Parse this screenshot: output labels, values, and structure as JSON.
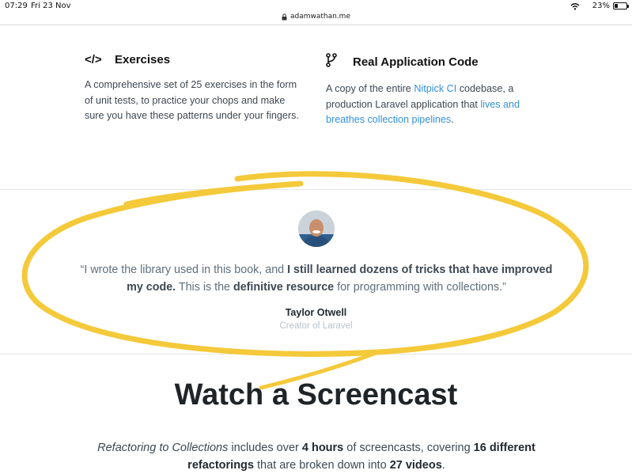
{
  "status_bar": {
    "time": "07:29",
    "date": "Fri 23 Nov",
    "battery": "23%",
    "battery_level": 0.23,
    "icons": [
      "wifi-icon",
      "moon-icon",
      "battery-icon"
    ]
  },
  "browser": {
    "url": "adamwathan.me",
    "lock_icon": "lock-icon"
  },
  "features": [
    {
      "icon": "code-icon",
      "icon_glyph": "</>",
      "title": "Exercises",
      "description": "A comprehensive set of 25 exercises in the form of unit tests, to practice your chops and make sure you have these patterns under your fingers."
    },
    {
      "icon": "branch-icon",
      "title": "Real Application Code",
      "desc_part1": "A copy of the entire ",
      "link1": "Nitpick CI",
      "desc_part2": " codebase, a production Laravel application that ",
      "link2": "lives and breathes collection pipelines",
      "desc_part3": "."
    }
  ],
  "testimonial": {
    "avatar": "avatar",
    "quote_open": "“I wrote the library used in this book, and ",
    "quote_bold1": "I still learned dozens of tricks that have improved my code.",
    "quote_mid": " This is the ",
    "quote_bold2": "definitive resource",
    "quote_end": " for programming with collections.”",
    "author": "Taylor Otwell",
    "role": "Creator of Laravel"
  },
  "screencast": {
    "title": "Watch a Screencast",
    "text_italic": "Refactoring to Collections",
    "text_1": " includes over ",
    "text_bold1": "4 hours",
    "text_2": " of screencasts, covering ",
    "text_bold2": "16 different refactorings",
    "text_3": " that are broken down into ",
    "text_bold3": "27 videos",
    "text_4": "."
  },
  "colors": {
    "highlight": "#f4c93a",
    "link": "#3490dc"
  }
}
